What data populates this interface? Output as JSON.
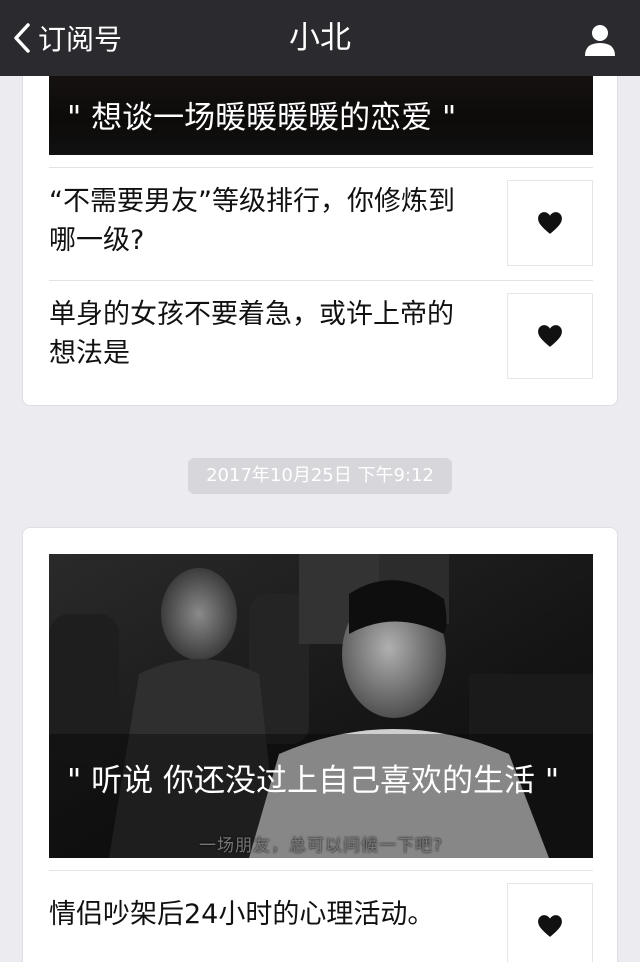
{
  "header": {
    "back_label": "订阅号",
    "title": "小北"
  },
  "card1": {
    "cover_caption": "\" 想谈一场暖暖暖暖的恋爱 \"",
    "items": [
      {
        "title": "“不需要男友”等级排行，你修炼到哪一级?",
        "thumb_icon": "heart-icon"
      },
      {
        "title": "单身的女孩不要着急，或许上帝的想法是",
        "thumb_icon": "heart-icon"
      }
    ]
  },
  "timestamp": "2017年10月25日 下午9:12",
  "card2": {
    "cover_caption": "\" 听说 你还没过上自己喜欢的生活 \"",
    "cover_subtitle": "一场朋友，总可以问候一下吧?",
    "items": [
      {
        "title": "情侣吵架后24小时的心理活动。",
        "thumb_icon": "heart-icon"
      }
    ]
  },
  "colors": {
    "topbar": "#2b2b2f",
    "background": "#ececf0",
    "card": "#ffffff",
    "timestamp_bg": "#d6d6db"
  }
}
